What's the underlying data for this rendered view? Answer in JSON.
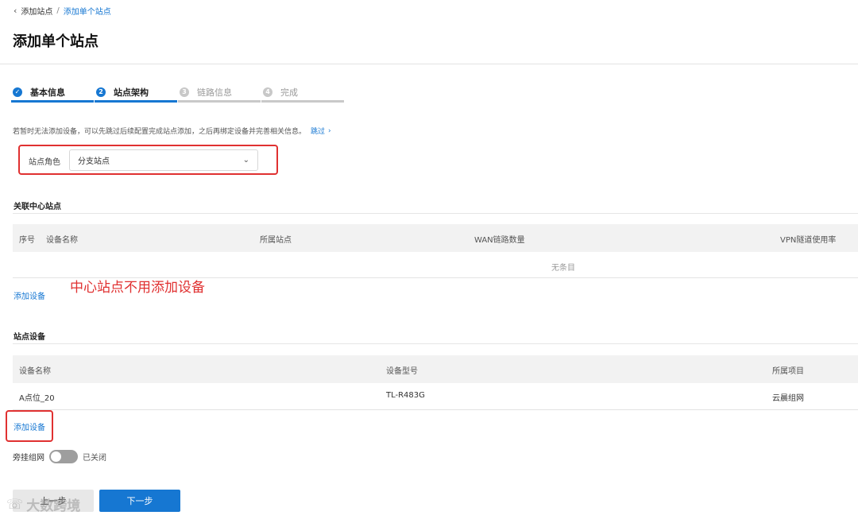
{
  "breadcrumb": {
    "parent": "添加站点",
    "separator": "/",
    "current": "添加单个站点"
  },
  "page_title": "添加单个站点",
  "steps": [
    {
      "index": "✓",
      "label": "基本信息"
    },
    {
      "index": "2",
      "label": "站点架构"
    },
    {
      "index": "3",
      "label": "链路信息"
    },
    {
      "index": "4",
      "label": "完成"
    }
  ],
  "hint": {
    "text": "若暂时无法添加设备，可以先跳过后续配置完成站点添加，之后再绑定设备并完善相关信息。",
    "skip_label": "跳过"
  },
  "role": {
    "label": "站点角色",
    "value": "分支站点"
  },
  "center_section": {
    "title": "关联中心站点",
    "columns": [
      "序号",
      "设备名称",
      "所属站点",
      "WAN链路数量",
      "VPN隧道使用率"
    ],
    "empty_text": "无条目",
    "add_label": "添加设备",
    "annotation": "中心站点不用添加设备"
  },
  "site_devices": {
    "title": "站点设备",
    "columns": [
      "设备名称",
      "设备型号",
      "所属项目"
    ],
    "rows": [
      {
        "name": "A点位_20",
        "model": "TL-R483G",
        "project": "云晨组网"
      }
    ],
    "add_label": "添加设备"
  },
  "bypass": {
    "label": "旁挂组网",
    "state": "已关闭",
    "enabled": false
  },
  "buttons": {
    "prev": "上一步",
    "next": "下一步"
  },
  "watermark": "大数跨境",
  "colors": {
    "primary": "#1677d2",
    "annotation": "#e03131"
  }
}
